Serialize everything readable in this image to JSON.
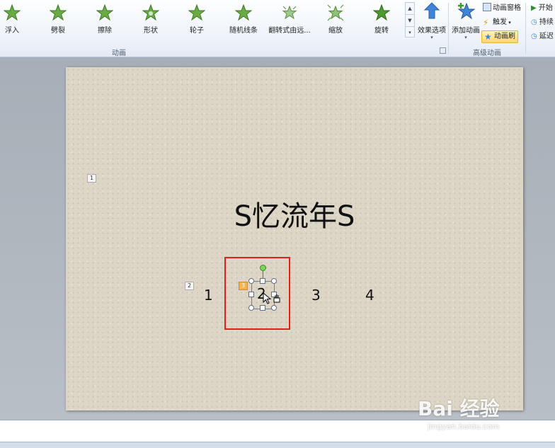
{
  "ribbon": {
    "gallery": [
      {
        "label": "浮入",
        "icon": "star-float-in-icon"
      },
      {
        "label": "劈裂",
        "icon": "star-split-icon"
      },
      {
        "label": "擦除",
        "icon": "star-wipe-icon"
      },
      {
        "label": "形状",
        "icon": "star-shape-icon"
      },
      {
        "label": "轮子",
        "icon": "star-wheel-icon"
      },
      {
        "label": "随机线条",
        "icon": "star-random-bars-icon"
      },
      {
        "label": "翻转式由远...",
        "icon": "star-flip-icon"
      },
      {
        "label": "缩放",
        "icon": "star-zoom-icon"
      },
      {
        "label": "旋转",
        "icon": "star-spin-icon"
      }
    ],
    "group_animation_label": "动画",
    "effect_options_label": "效果选项",
    "add_animation_label": "添加动画",
    "animation_pane_label": "动画窗格",
    "trigger_label": "触发",
    "animation_painter_label": "动画刷",
    "group_advanced_label": "高级动画",
    "timing": {
      "start_label": "开始",
      "duration_label": "持续",
      "delay_label": "延迟"
    }
  },
  "slide": {
    "title": "S忆流年S",
    "tags": [
      "1",
      "2",
      "3"
    ],
    "numbers": [
      "1",
      "2",
      "3",
      "4"
    ]
  },
  "watermark": {
    "main": "Bai 经验",
    "sub": "jingyan.baidu.com"
  },
  "colors": {
    "highlight": "#e02020",
    "star_green": "#4f9a2e",
    "arrow_blue": "#3f86d8"
  }
}
